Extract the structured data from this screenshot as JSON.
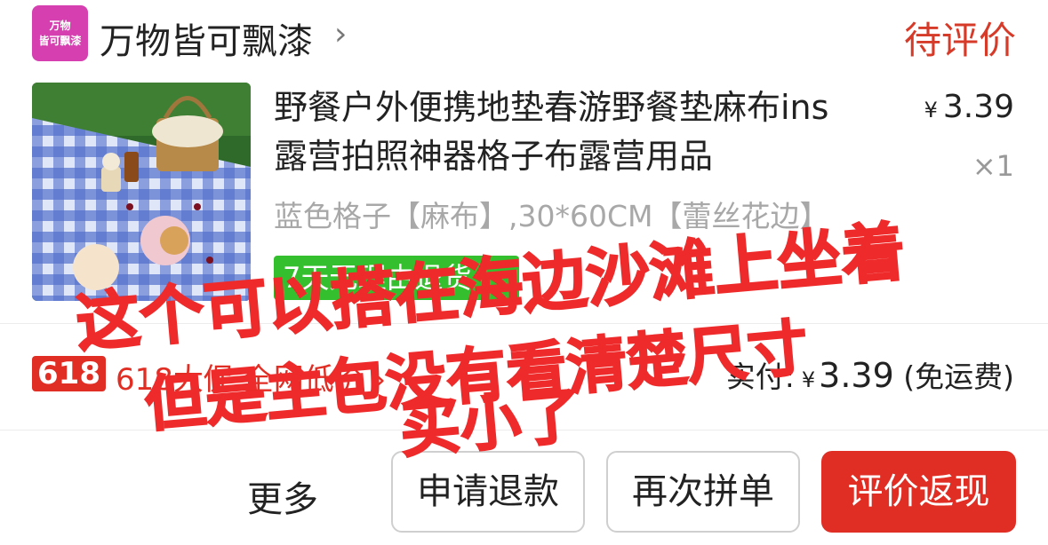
{
  "shop": {
    "logo_text": "万物\n皆可飘漆",
    "name": "万物皆可飘漆",
    "chevron": "›"
  },
  "order": {
    "status": "待评价"
  },
  "product": {
    "title": "野餐户外便携地垫春游野餐垫麻布ins露营拍照神器格子布露营用品",
    "price_symbol": "¥",
    "price": "3.39",
    "quantity": "×1",
    "spec": "蓝色格子【麻布】,30*60CM【蕾丝花边】",
    "tag": "7天无理由退货"
  },
  "promo": {
    "badge": "618",
    "text": "618大促·全网低价 ›"
  },
  "payment": {
    "label": "实付:",
    "symbol": "¥",
    "amount": "3.39",
    "note": "(免运费)"
  },
  "actions": {
    "more": "更多",
    "refund": "申请退款",
    "reorder": "再次拼单",
    "review": "评价返现"
  },
  "annotation": {
    "line1": "这个可以搭在海边沙滩上坐着",
    "line2": "但是主包没有看清楚尺寸",
    "line3": "买小了",
    "color": "#ee2a2a"
  }
}
